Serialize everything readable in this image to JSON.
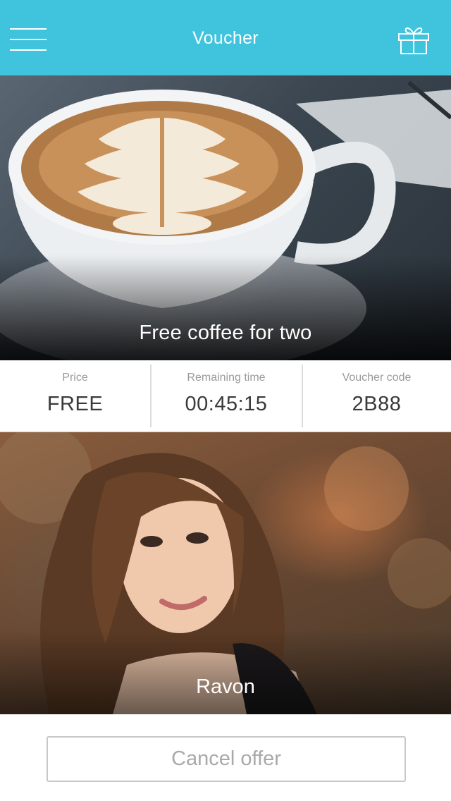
{
  "header": {
    "title": "Voucher",
    "menu_icon": "menu-icon",
    "gift_icon": "gift-icon",
    "background": "#40c3dd"
  },
  "offer": {
    "title": "Free coffee for two",
    "image": "latte-art-coffee-cup"
  },
  "details": {
    "price_label": "Price",
    "price_value": "FREE",
    "time_label": "Remaining time",
    "time_value": "00:45:15",
    "code_label": "Voucher code",
    "code_value": "2B88"
  },
  "person": {
    "name": "Ravon",
    "image": "smiling-woman-portrait"
  },
  "actions": {
    "cancel_label": "Cancel offer"
  }
}
